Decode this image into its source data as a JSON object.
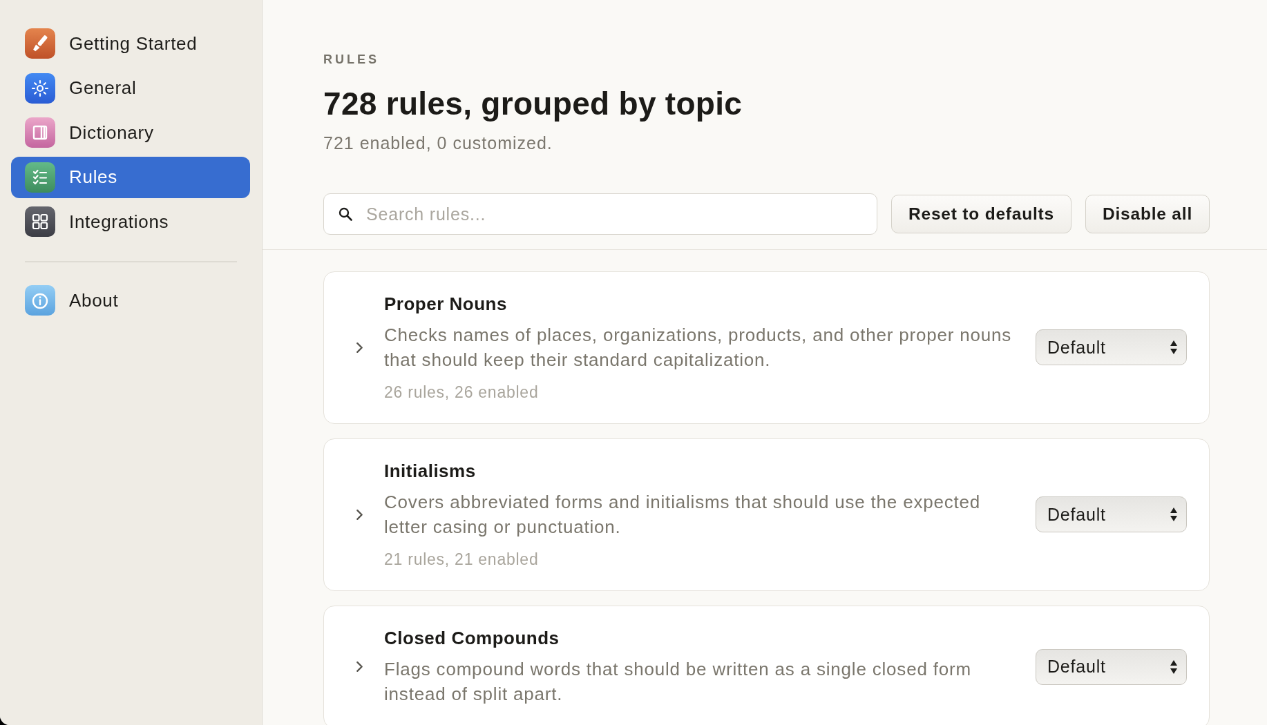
{
  "sidebar": {
    "groups": [
      {
        "items": [
          {
            "label": "Getting Started",
            "kind": "brush",
            "selected": false
          },
          {
            "label": "General",
            "kind": "sun",
            "selected": false
          },
          {
            "label": "Dictionary",
            "kind": "book",
            "selected": false
          },
          {
            "label": "Rules",
            "kind": "checklist",
            "selected": true
          },
          {
            "label": "Integrations",
            "kind": "grid",
            "selected": false
          }
        ]
      },
      {
        "items": [
          {
            "label": "About",
            "kind": "info",
            "selected": false
          }
        ]
      }
    ]
  },
  "header": {
    "section_label": "RULES",
    "title": "728 rules, grouped by topic",
    "subtitle": "721 enabled, 0 customized."
  },
  "search": {
    "placeholder": "Search rules..."
  },
  "buttons": [
    "Reset to defaults",
    "Disable all"
  ],
  "rule_groups": [
    {
      "title": "Proper Nouns",
      "description": "Checks names of places, organizations, products, and other proper nouns that should keep their standard capitalization.",
      "count": "26 rules, 26 enabled",
      "expanded": false,
      "mode": "Default"
    },
    {
      "title": "Initialisms",
      "description": "Covers abbreviated forms and initialisms that should use the expected letter casing or punctuation.",
      "count": "21 rules, 21 enabled",
      "expanded": false,
      "mode": "Default"
    },
    {
      "title": "Closed Compounds",
      "description": "Flags compound words that should be written as a single closed form instead of split apart.",
      "expanded": false,
      "mode": "Default"
    }
  ]
}
